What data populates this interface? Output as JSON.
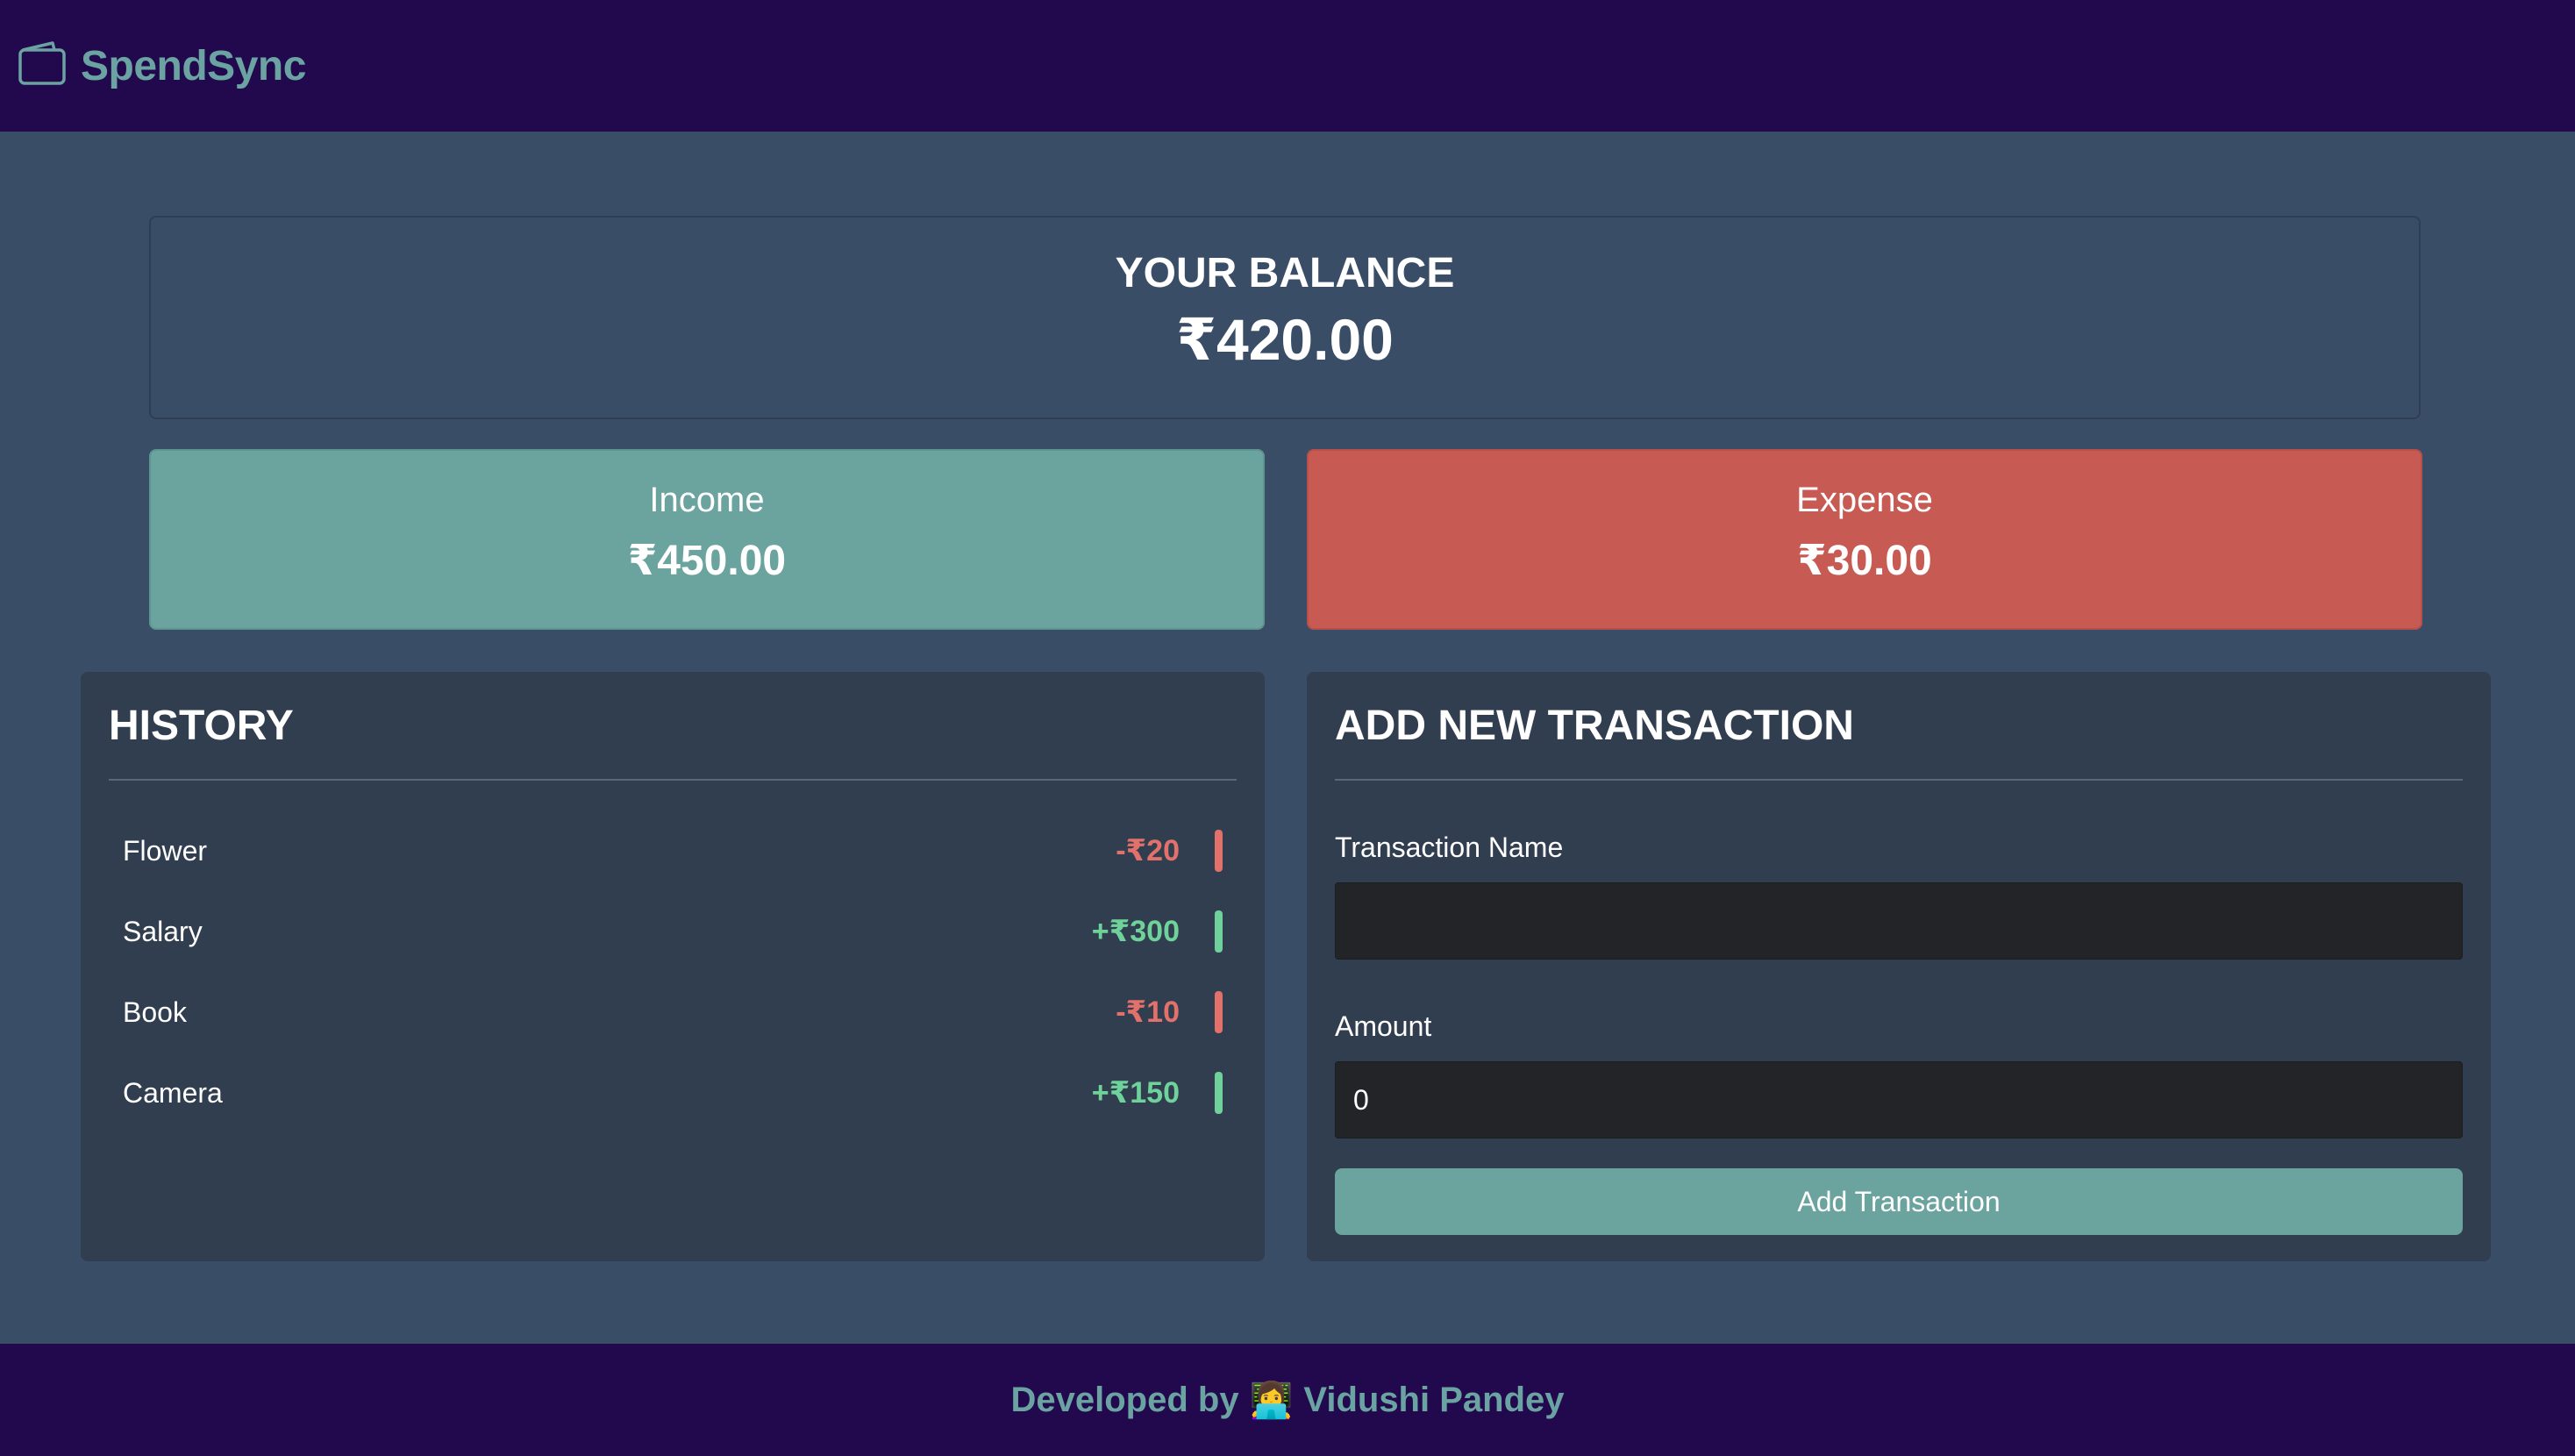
{
  "header": {
    "brand": "SpendSync",
    "logo_icon": "wallet-icon",
    "brand_color": "#6aa3a1",
    "bg_color": "#22094e"
  },
  "balance": {
    "title": "YOUR BALANCE",
    "value": "₹420.00"
  },
  "income": {
    "label": "Income",
    "value": "₹450.00",
    "color": "#6ba39f"
  },
  "expense": {
    "label": "Expense",
    "value": "₹30.00",
    "color": "#c75b54"
  },
  "history": {
    "title": "HISTORY",
    "items": [
      {
        "name": "Flower",
        "amount": "-₹20",
        "type": "expense"
      },
      {
        "name": "Salary",
        "amount": "+₹300",
        "type": "income"
      },
      {
        "name": "Book",
        "amount": "-₹10",
        "type": "expense"
      },
      {
        "name": "Camera",
        "amount": "+₹150",
        "type": "income"
      }
    ]
  },
  "add_transaction": {
    "title": "ADD NEW TRANSACTION",
    "name_label": "Transaction Name",
    "name_value": "",
    "amount_label": "Amount",
    "amount_value": "0",
    "button_label": "Add Transaction"
  },
  "footer": {
    "prefix": "Developed by",
    "emoji": "👩‍💻",
    "author": "Vidushi Pandey"
  }
}
